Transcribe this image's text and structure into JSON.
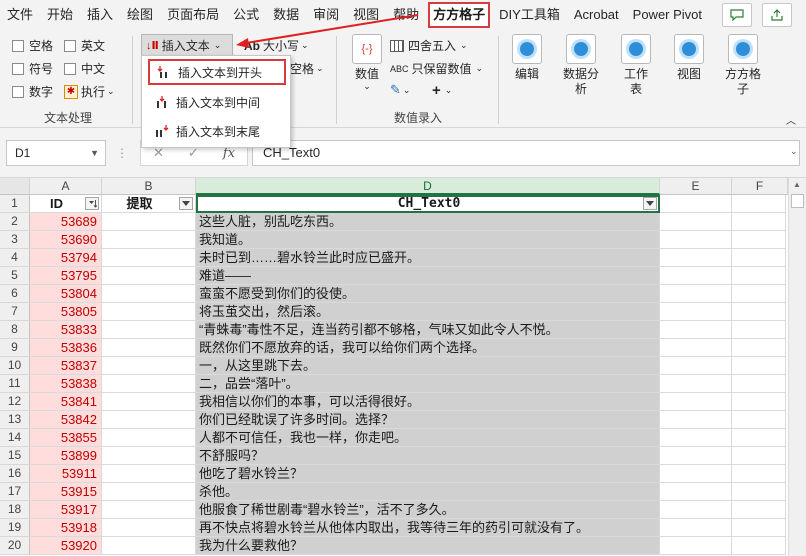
{
  "tabs": [
    "文件",
    "开始",
    "插入",
    "绘图",
    "页面布局",
    "公式",
    "数据",
    "审阅",
    "视图",
    "帮助",
    "方方格子",
    "DIY工具箱",
    "Acrobat",
    "Power Pivot"
  ],
  "ribbon": {
    "text_group": {
      "checkboxes": [
        "空格",
        "英文",
        "符号",
        "中文",
        "数字"
      ],
      "execute": "执行",
      "label": "文本处理"
    },
    "insert_text": "插入文本",
    "size": "大小写",
    "space_fragment": "空格",
    "data_group": {
      "value": "数值",
      "round": "四舍五入",
      "keep_value": "只保留数值",
      "label": "数值录入"
    },
    "big_buttons": [
      "编辑",
      "数据分析",
      "工作表",
      "视图",
      "方方格子"
    ]
  },
  "menu": {
    "items": [
      "插入文本到开头",
      "插入文本到中间",
      "插入文本到末尾"
    ]
  },
  "formula_bar": {
    "name_box": "D1",
    "formula": "CH_Text0",
    "fx": "fx"
  },
  "columns": {
    "A": "A",
    "B": "B",
    "D": "D",
    "E": "E",
    "F": "F"
  },
  "headers": {
    "id": "ID",
    "extract": "提取",
    "text": "CH_Text0"
  },
  "rows": [
    {
      "n": "2",
      "id": "53689",
      "text": "这些人脏，别乱吃东西。"
    },
    {
      "n": "3",
      "id": "53690",
      "text": "我知道。"
    },
    {
      "n": "4",
      "id": "53794",
      "text": "未时已到……碧水铃兰此时应已盛开。"
    },
    {
      "n": "5",
      "id": "53795",
      "text": "难道——"
    },
    {
      "n": "6",
      "id": "53804",
      "text": "蛮蛮不愿受到你们的役使。"
    },
    {
      "n": "7",
      "id": "53805",
      "text": "将玉茧交出，然后滚。"
    },
    {
      "n": "8",
      "id": "53833",
      "text": "“青蛛毒”毒性不足，连当药引都不够格，气味又如此令人不悦。"
    },
    {
      "n": "9",
      "id": "53836",
      "text": "既然你们不愿放弃的话，我可以给你们两个选择。"
    },
    {
      "n": "10",
      "id": "53837",
      "text": "一，从这里跳下去。"
    },
    {
      "n": "11",
      "id": "53838",
      "text": "二，品尝“落叶”。"
    },
    {
      "n": "12",
      "id": "53841",
      "text": "我相信以你们的本事，可以活得很好。"
    },
    {
      "n": "13",
      "id": "53842",
      "text": "你们已经耽误了许多时间。选择？"
    },
    {
      "n": "14",
      "id": "53855",
      "text": "人都不可信任，我也一样，你走吧。"
    },
    {
      "n": "15",
      "id": "53899",
      "text": "不舒服吗？"
    },
    {
      "n": "16",
      "id": "53911",
      "text": "他吃了碧水铃兰？"
    },
    {
      "n": "17",
      "id": "53915",
      "text": "杀他。"
    },
    {
      "n": "18",
      "id": "53917",
      "text": "他服食了稀世剧毒“碧水铃兰”，活不了多久。"
    },
    {
      "n": "19",
      "id": "53918",
      "text": "再不快点将碧水铃兰从他体内取出，我等待三年的药引可就没有了。"
    },
    {
      "n": "20",
      "id": "53920",
      "text": "我为什么要救他？"
    }
  ]
}
